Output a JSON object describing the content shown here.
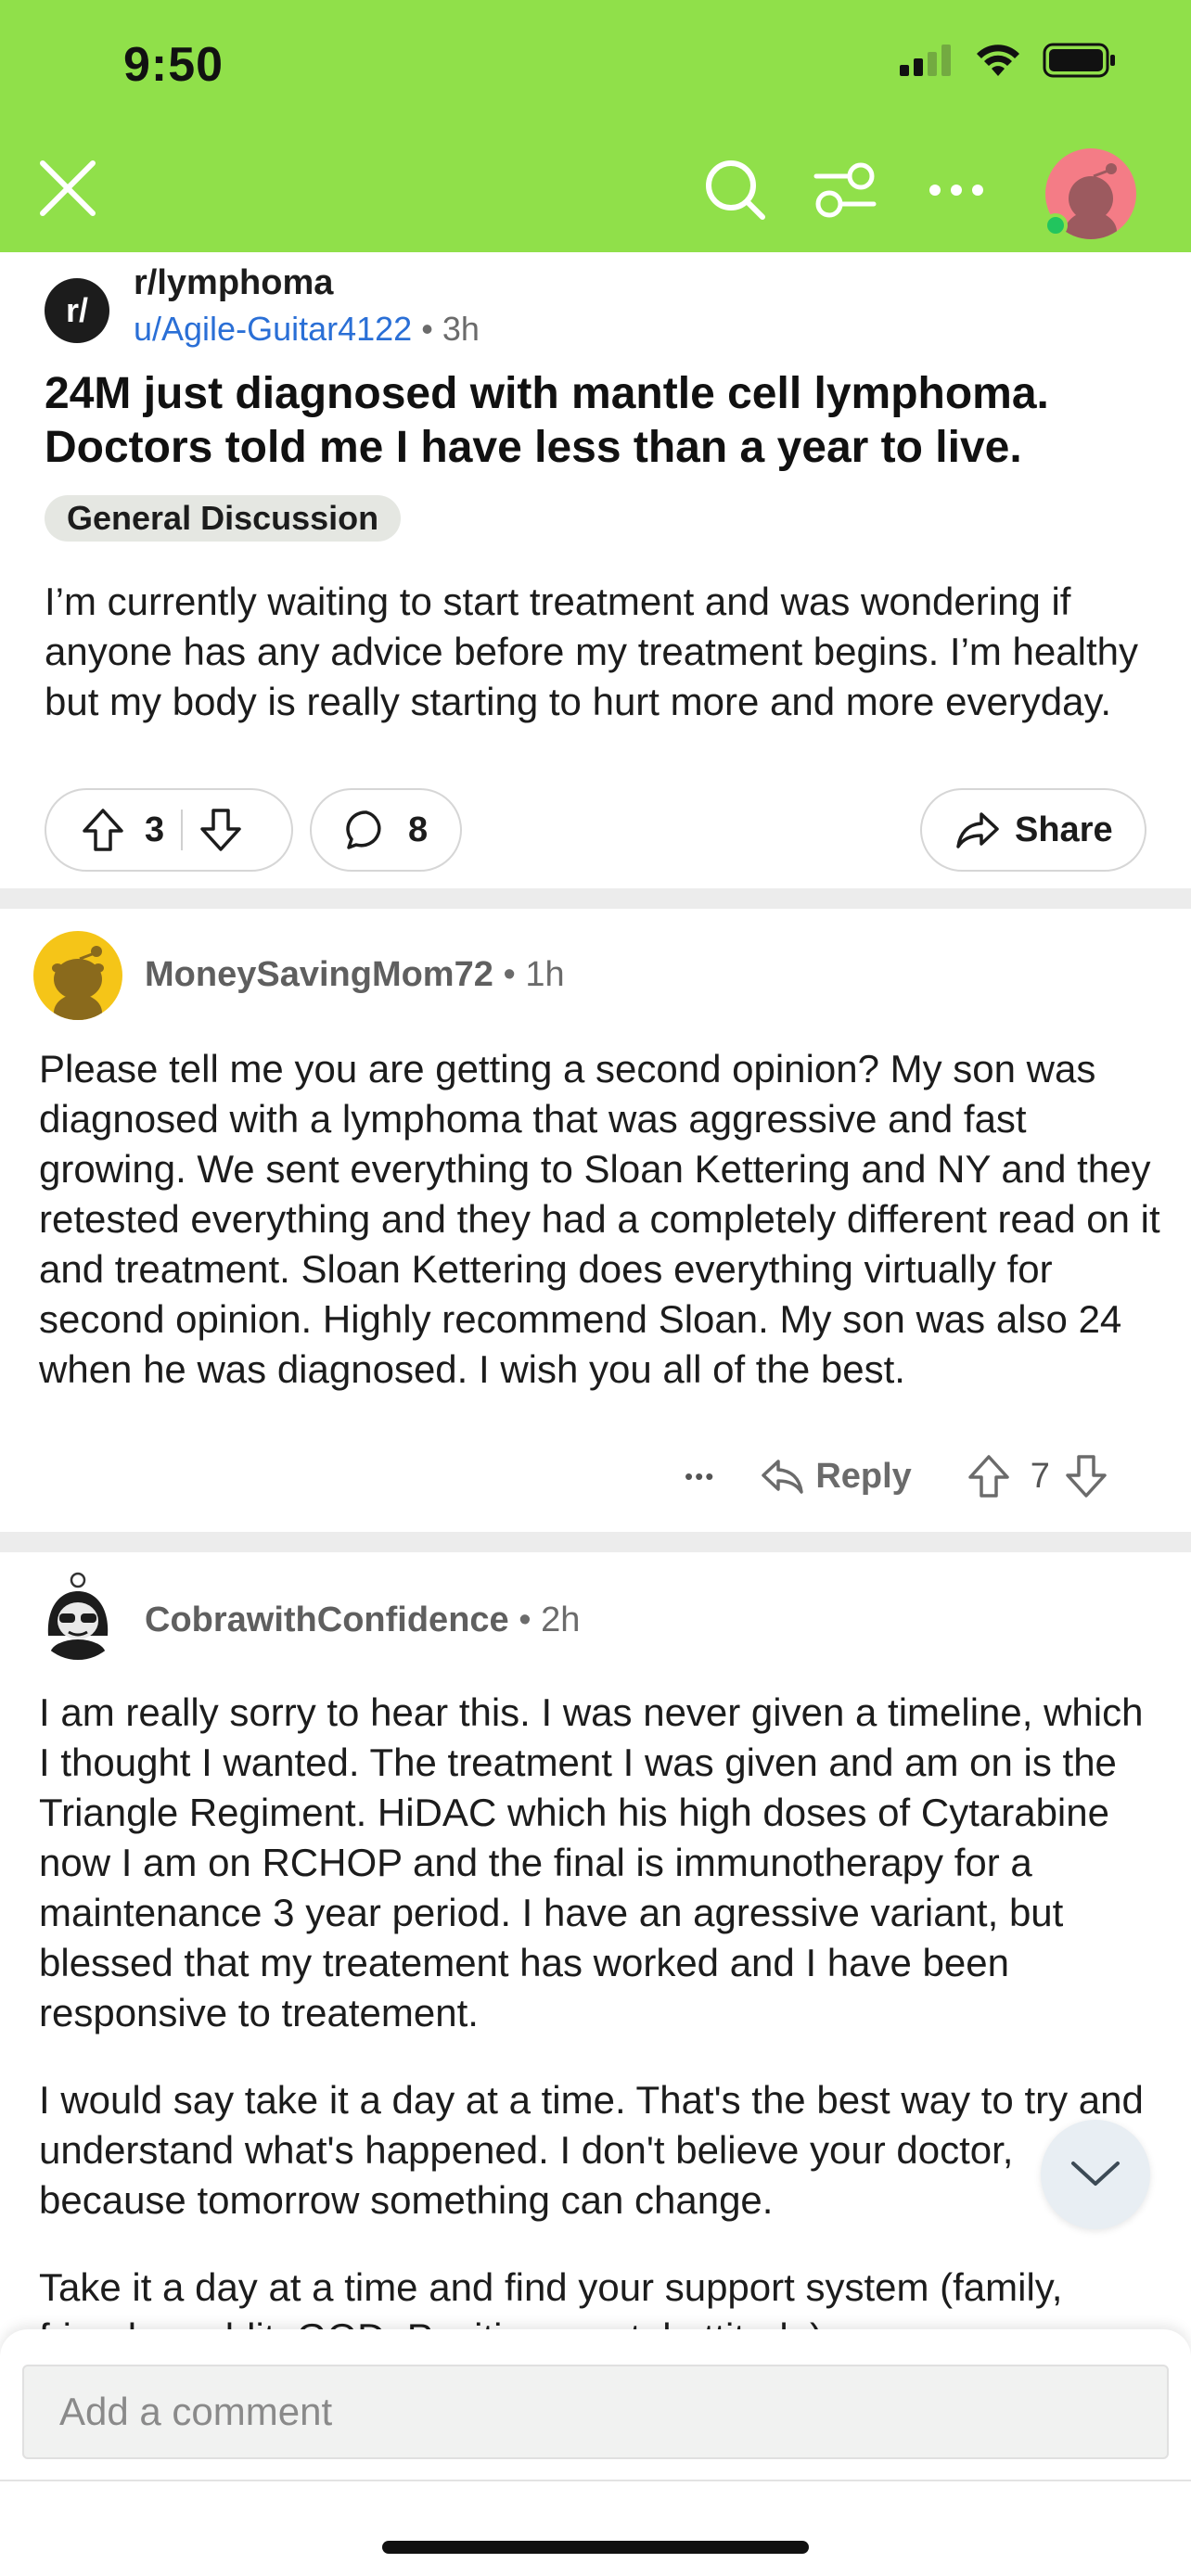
{
  "status_bar": {
    "time": "9:50"
  },
  "header": {
    "icons": [
      "close-icon",
      "search-icon",
      "filter-icon",
      "more-icon",
      "avatar"
    ],
    "bg_color": "#90e04a"
  },
  "post": {
    "subreddit": "r/lymphoma",
    "subreddit_icon_text": "r/",
    "author": "u/Agile-Guitar4122",
    "separator": "•",
    "age": "3h",
    "title": "24M just diagnosed with mantle cell lymphoma. Doctors told me I have less than a year to live.",
    "flair": "General Discussion",
    "body": "I’m currently waiting to start treatment and was wondering if anyone has any advice before my treatment begins. I’m healthy but my body is really starting to hurt more and more everyday.",
    "votes": "3",
    "comments": "8",
    "share_label": "Share"
  },
  "comments": [
    {
      "author": "MoneySavingMom72",
      "separator": "•",
      "age": "1h",
      "body": "Please tell me you are getting a second opinion? My son was diagnosed with a lymphoma that was aggressive and fast growing. We sent everything to Sloan Kettering and NY and they retested everything and they had a completely different read on it and treatment. Sloan Kettering does everything virtually for second opinion. Highly recommend Sloan. My son was also 24 when he was diagnosed. I wish you all of the best.",
      "more": "•••",
      "reply_label": "Reply",
      "votes": "7"
    },
    {
      "author": "CobrawithConfidence",
      "separator": "•",
      "age": "2h",
      "paragraphs": [
        "I am really sorry to hear this. I was never given a timeline, which I thought I wanted. The treatment I was  given and am on is the Triangle Regiment. HiDAC which his high doses of Cytarabine now I am on RCHOP and the final is immunotherapy for a maintenance 3 year period. I have an agressive variant, but blessed that my treatement has worked and I have been responsive to treatement.",
        "I would say take it a day at a time. That's the best way to try and understand what's happened. I don't believe your doctor, because tomorrow something can change.",
        "Take it a day at a time and find your support system (family, friends, reddit, GOD, Positive mental attitude)"
      ]
    }
  ],
  "composer": {
    "placeholder": "Add a comment"
  }
}
